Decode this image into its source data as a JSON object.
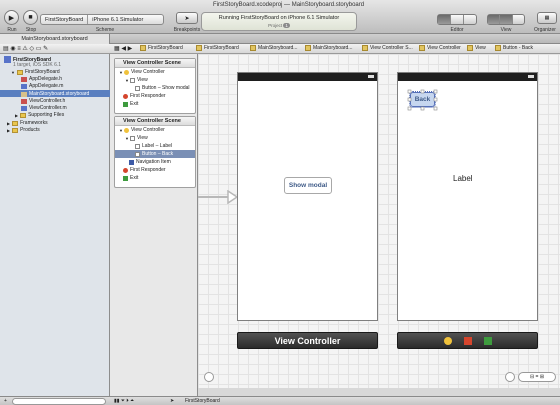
{
  "toolbar": {
    "run_label": "Run",
    "stop_label": "Stop",
    "scheme_label": "Scheme",
    "breakpoints_label": "Breakpoints",
    "editor_label": "Editor",
    "view_label": "View",
    "organizer_label": "Organizer",
    "scheme_target": "FirstStoryBoard",
    "scheme_device": "iPhone 6.1 Simulator",
    "window_title_project": "FirstStoryBoard.xcodeproj",
    "window_title_sep": "—",
    "window_title_file": "MainStoryboard.storyboard",
    "activity_status": "Running FirstStoryBoard on iPhone 6.1 Simulator",
    "activity_sub": "Project",
    "activity_count": "1"
  },
  "tab": {
    "label": "MainStoryboard.storyboard"
  },
  "jumpbar": {
    "crumbs": [
      "FirstStoryBoard",
      "FirstStoryBoard",
      "MainStoryboard...",
      "MainStoryboard...",
      "View Controller S...",
      "View Controller",
      "View",
      "Button - Back"
    ]
  },
  "navigator": {
    "project_name": "FirstStoryBoard",
    "project_sub": "1 target, iOS SDK 6.1",
    "items": [
      "FirstStoryBoard",
      "AppDelegate.h",
      "AppDelegate.m",
      "MainStoryboard.storyboard",
      "ViewController.h",
      "ViewController.m",
      "Supporting Files",
      "Frameworks",
      "Products"
    ]
  },
  "outline": {
    "scene1": {
      "title": "View Controller Scene",
      "rows": [
        "View Controller",
        "View",
        "Button – Show modal",
        "First Responder",
        "Exit"
      ]
    },
    "scene2": {
      "title": "View Controller Scene",
      "rows": [
        "View Controller",
        "View",
        "Label – Label",
        "Button – Back",
        "Navigation Item",
        "First Responder",
        "Exit"
      ]
    }
  },
  "canvas": {
    "show_modal_label": "Show modal",
    "back_label": "Back",
    "label_text": "Label",
    "dock1_label": "View Controller"
  },
  "bottom": {
    "filename": "FirstStoryBoard"
  }
}
